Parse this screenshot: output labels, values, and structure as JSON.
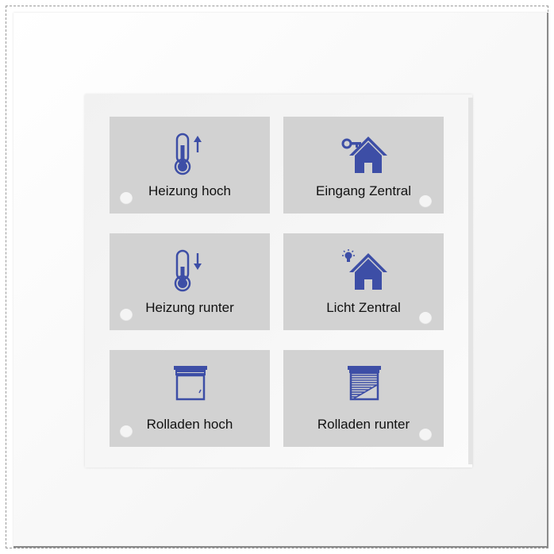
{
  "panel": {
    "buttons": [
      {
        "label": "Heizung hoch",
        "icon": "thermometer-up-icon"
      },
      {
        "label": "Eingang Zentral",
        "icon": "house-key-icon"
      },
      {
        "label": "Heizung runter",
        "icon": "thermometer-down-icon"
      },
      {
        "label": "Licht Zentral",
        "icon": "house-light-icon"
      },
      {
        "label": "Rolladen hoch",
        "icon": "shutter-up-icon"
      },
      {
        "label": "Rolladen runter",
        "icon": "shutter-down-icon"
      }
    ]
  },
  "colors": {
    "icon": "#3d4ea6",
    "button": "#d2d2d2",
    "led": "#f4f4f4"
  }
}
